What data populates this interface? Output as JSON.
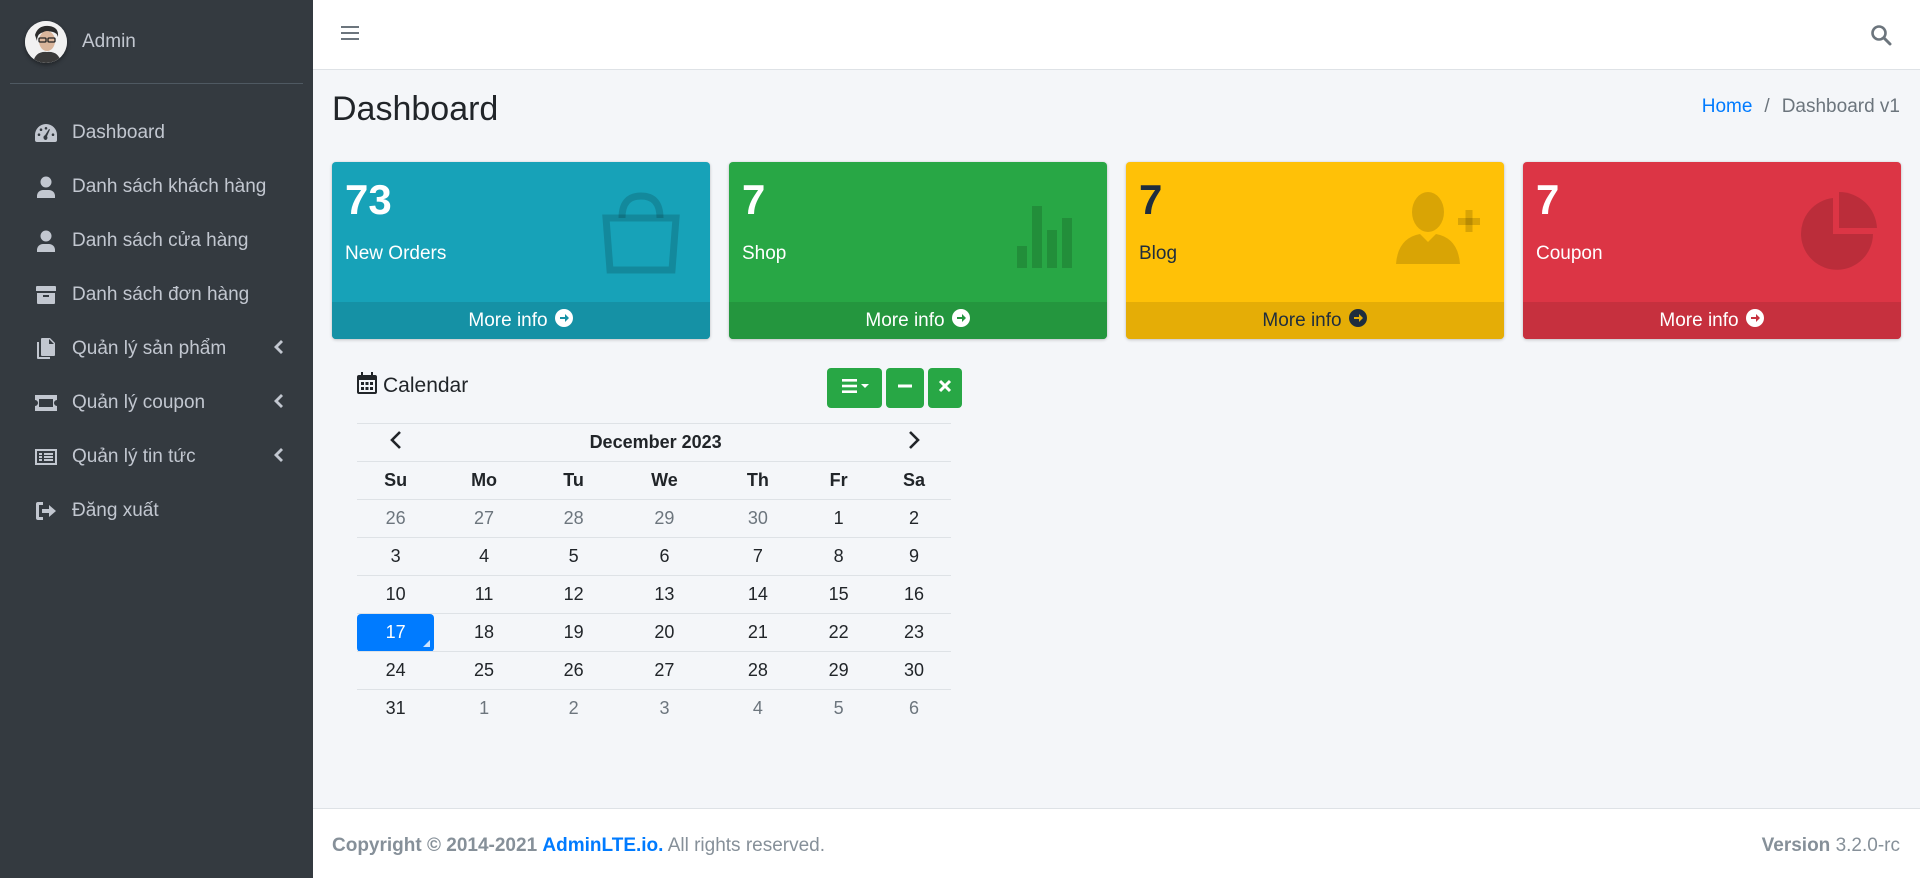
{
  "sidebar": {
    "user_name": "Admin",
    "items": [
      {
        "label": "Dashboard",
        "icon": "tachometer-icon"
      },
      {
        "label": "Danh sách khách hàng",
        "icon": "user-icon"
      },
      {
        "label": "Danh sách cửa hàng",
        "icon": "user-icon"
      },
      {
        "label": "Danh sách đơn hàng",
        "icon": "box-icon"
      },
      {
        "label": "Quản lý sản phẩm",
        "icon": "copy-icon"
      },
      {
        "label": "Quản lý coupon",
        "icon": "ticket-icon"
      },
      {
        "label": "Quản lý tin tức",
        "icon": "list-icon"
      },
      {
        "label": "Đăng xuất",
        "icon": "sign-out-icon"
      }
    ]
  },
  "header": {
    "menu_icon": "hamburger-icon",
    "search_icon": "search-icon"
  },
  "page": {
    "title": "Dashboard",
    "breadcrumb": {
      "home": "Home",
      "separator": "/",
      "current": "Dashboard v1"
    }
  },
  "boxes": [
    {
      "value": "73",
      "label": "New Orders",
      "more": "More info",
      "color": "#17a2b8",
      "icon": "shopping-bag-icon"
    },
    {
      "value": "7",
      "label": "Shop",
      "more": "More info",
      "color": "#28a745",
      "icon": "bar-chart-icon"
    },
    {
      "value": "7",
      "label": "Blog",
      "more": "More info",
      "color": "#ffc107",
      "icon": "user-plus-icon"
    },
    {
      "value": "7",
      "label": "Coupon",
      "more": "More info",
      "color": "#dc3545",
      "icon": "pie-chart-icon"
    }
  ],
  "calendar": {
    "title": "Calendar",
    "month": "December 2023",
    "weekdays": [
      "Su",
      "Mo",
      "Tu",
      "We",
      "Th",
      "Fr",
      "Sa"
    ],
    "weeks": [
      [
        "26",
        "27",
        "28",
        "29",
        "30",
        "1",
        "2"
      ],
      [
        "3",
        "4",
        "5",
        "6",
        "7",
        "8",
        "9"
      ],
      [
        "10",
        "11",
        "12",
        "13",
        "14",
        "15",
        "16"
      ],
      [
        "17",
        "18",
        "19",
        "20",
        "21",
        "22",
        "23"
      ],
      [
        "24",
        "25",
        "26",
        "27",
        "28",
        "29",
        "30"
      ],
      [
        "31",
        "1",
        "2",
        "3",
        "4",
        "5",
        "6"
      ]
    ],
    "selected_day": "17"
  },
  "footer": {
    "copyright": "Copyright © 2014-2021",
    "brand": "AdminLTE.io.",
    "rights": "All rights reserved.",
    "version_label": "Version",
    "version": "3.2.0-rc"
  }
}
